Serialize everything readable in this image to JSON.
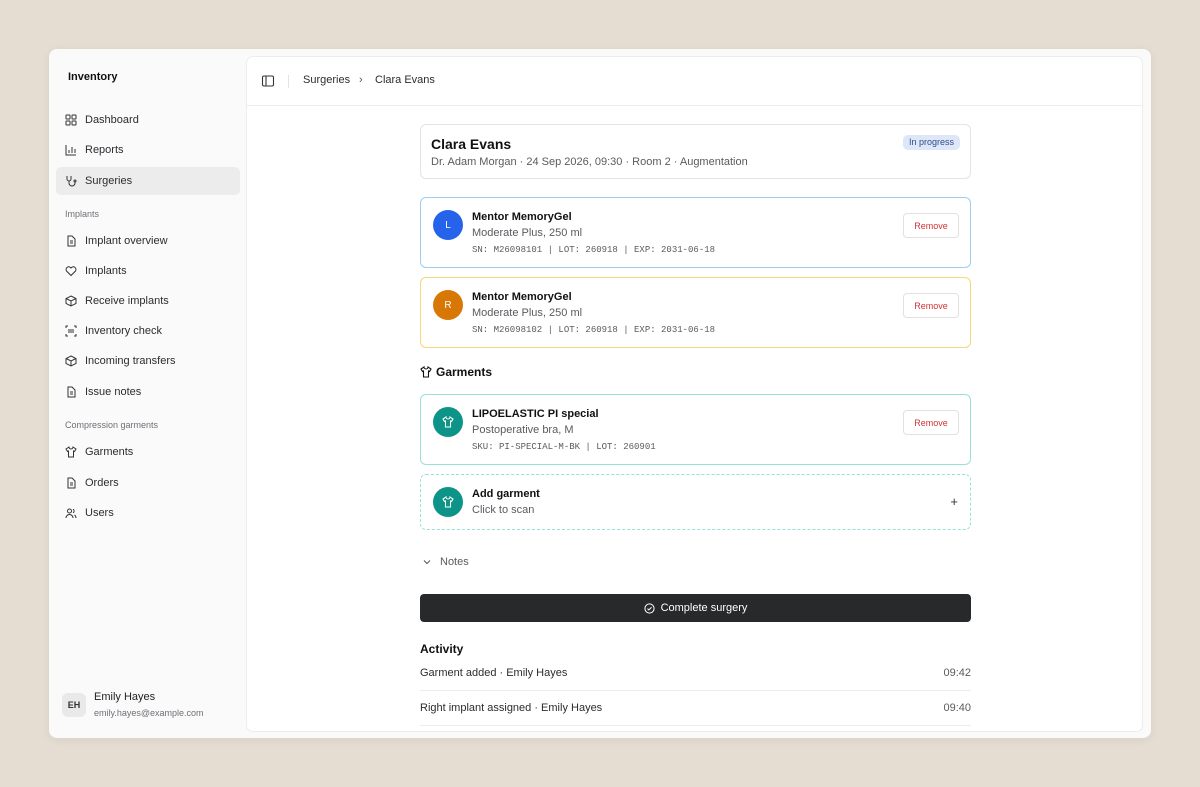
{
  "sidebar": {
    "brand": "Inventory",
    "nav": [
      {
        "label": "Dashboard",
        "icon": "grid-icon"
      },
      {
        "label": "Reports",
        "icon": "bar-chart-icon"
      },
      {
        "label": "Surgeries",
        "icon": "stethoscope-icon",
        "active": true
      }
    ],
    "implants_label": "Implants",
    "implants_nav": [
      {
        "label": "Implant overview",
        "icon": "document-icon"
      },
      {
        "label": "Implants",
        "icon": "heart-icon"
      },
      {
        "label": "Receive implants",
        "icon": "box-icon"
      },
      {
        "label": "Inventory check",
        "icon": "scan-icon"
      },
      {
        "label": "Incoming transfers",
        "icon": "box-icon"
      },
      {
        "label": "Issue notes",
        "icon": "document-icon"
      }
    ],
    "garments_label": "Compression garments",
    "garments_nav": [
      {
        "label": "Garments",
        "icon": "shirt-icon"
      },
      {
        "label": "Orders",
        "icon": "document-icon"
      },
      {
        "label": "Users",
        "icon": "users-icon"
      }
    ],
    "user": {
      "initials": "EH",
      "name": "Emily Hayes",
      "email": "emily.hayes@example.com"
    }
  },
  "breadcrumb": {
    "parent": "Surgeries",
    "separator": "›",
    "current": "Clara Evans"
  },
  "surgery": {
    "patient": "Clara Evans",
    "meta": "Dr. Adam Morgan · 24 Sep 2026, 09:30 · Room 2 · Augmentation",
    "status": "In progress"
  },
  "implants": [
    {
      "side": "L",
      "name": "Mentor MemoryGel",
      "spec": "Moderate Plus, 250 ml",
      "code": "SN: M26098101 | LOT: 260918 | EXP: 2031-06-18",
      "remove": "Remove",
      "circle_color": "#2563eb",
      "border_color": "#9fcdf1"
    },
    {
      "side": "R",
      "name": "Mentor MemoryGel",
      "spec": "Moderate Plus, 250 ml",
      "code": "SN: M26098102 | LOT: 260918 | EXP: 2031-06-18",
      "remove": "Remove",
      "circle_color": "#d97706",
      "border_color": "#f6d77a"
    }
  ],
  "garments": {
    "title": "Garments",
    "items": [
      {
        "name": "LIPOELASTIC PI special",
        "spec": "Postoperative bra, M",
        "code": "SKU: PI-SPECIAL-M-BK | LOT: 260901",
        "remove": "Remove",
        "circle_color": "#0d9488",
        "border_color": "#98e0d8"
      }
    ],
    "add": {
      "title": "Add garment",
      "subtitle": "Click to scan",
      "plus": "+"
    }
  },
  "notes_label": "Notes",
  "complete_label": "Complete surgery",
  "activity": {
    "title": "Activity",
    "rows": [
      {
        "text": "Garment added · Emily Hayes",
        "time": "09:42"
      },
      {
        "text": "Right implant assigned · Emily Hayes",
        "time": "09:40"
      }
    ]
  }
}
